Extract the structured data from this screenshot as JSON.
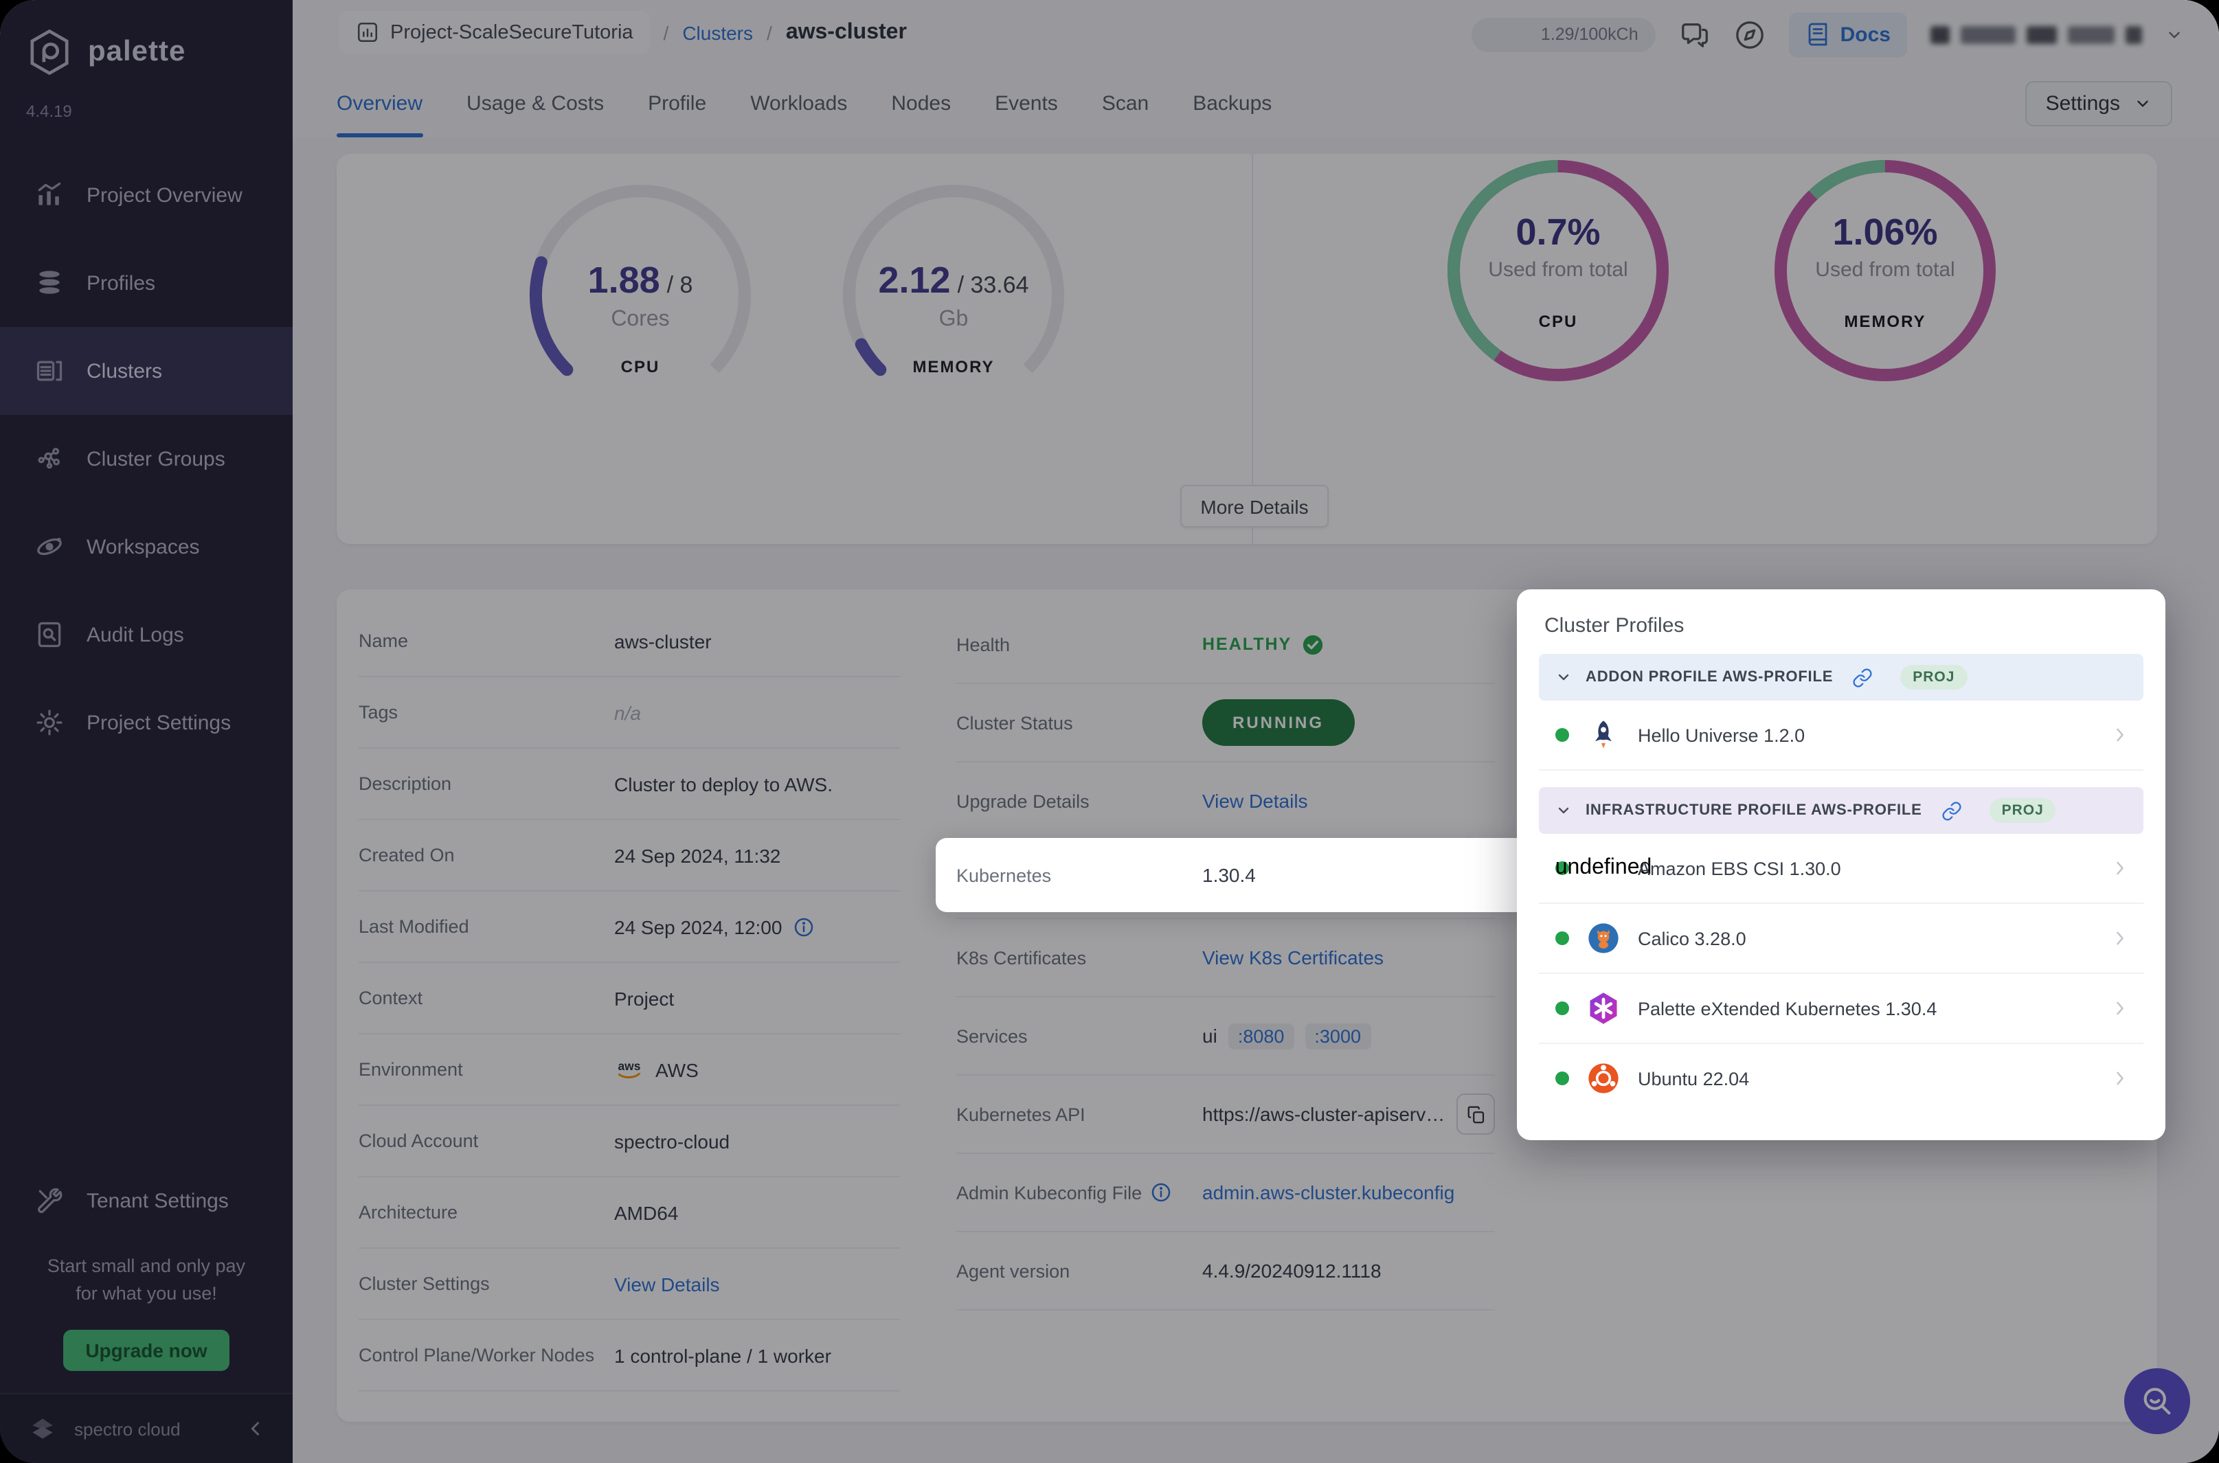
{
  "sidebar": {
    "logo_text": "palette",
    "version": "4.4.19",
    "items": [
      {
        "icon": "chart",
        "label": "Project Overview",
        "active": false
      },
      {
        "icon": "layers",
        "label": "Profiles",
        "active": false
      },
      {
        "icon": "server",
        "label": "Clusters",
        "active": true
      },
      {
        "icon": "network",
        "label": "Cluster Groups",
        "active": false
      },
      {
        "icon": "orbit",
        "label": "Workspaces",
        "active": false
      },
      {
        "icon": "audit",
        "label": "Audit Logs",
        "active": false
      },
      {
        "icon": "gear",
        "label": "Project Settings",
        "active": false
      }
    ],
    "tenant_item": {
      "icon": "tools",
      "label": "Tenant Settings"
    },
    "upsell_line1": "Start small and only pay",
    "upsell_line2": "for what you use!",
    "upgrade_label": "Upgrade now",
    "footer_brand": "spectro cloud"
  },
  "header": {
    "project_name": "Project-ScaleSecureTutoria",
    "breadcrumb_sep": "/",
    "clusters_link": "Clusters",
    "current": "aws-cluster",
    "usage_pill": "1.29/100kCh",
    "docs_label": "Docs",
    "settings_label": "Settings"
  },
  "tabs": {
    "active": "Overview",
    "items": [
      "Overview",
      "Usage & Costs",
      "Profile",
      "Workloads",
      "Nodes",
      "Events",
      "Scan",
      "Backups"
    ]
  },
  "gauges": {
    "cpu": {
      "value": "1.88",
      "total": "/ 8",
      "unit": "Cores",
      "label": "CPU",
      "used": 1.88,
      "capacity": 8
    },
    "memory": {
      "value": "2.12",
      "total": "/ 33.64",
      "unit": "Gb",
      "label": "MEMORY",
      "used": 2.12,
      "capacity": 33.64
    },
    "more_details_label": "More Details"
  },
  "donuts": {
    "cpu": {
      "percent_text": "0.7%",
      "caption": "Used from total",
      "label": "CPU",
      "green_fraction": 0.4
    },
    "memory": {
      "percent_text": "1.06%",
      "caption": "Used from total",
      "label": "MEMORY",
      "green_fraction": 0.12
    }
  },
  "details_left": [
    {
      "label": "Name",
      "type": "text",
      "value": "aws-cluster"
    },
    {
      "label": "Tags",
      "type": "na",
      "value": "n/a"
    },
    {
      "label": "Description",
      "type": "text",
      "value": "Cluster to deploy to AWS."
    },
    {
      "label": "Created On",
      "type": "text",
      "value": "24 Sep 2024, 11:32"
    },
    {
      "label": "Last Modified",
      "type": "text-info",
      "value": "24 Sep 2024, 12:00"
    },
    {
      "label": "Context",
      "type": "text",
      "value": "Project"
    },
    {
      "label": "Environment",
      "type": "env-aws",
      "value": "AWS"
    },
    {
      "label": "Cloud Account",
      "type": "text",
      "value": "spectro-cloud"
    },
    {
      "label": "Architecture",
      "type": "text",
      "value": "AMD64"
    },
    {
      "label": "Cluster Settings",
      "type": "link",
      "value": "View Details"
    },
    {
      "label": "Control Plane/Worker Nodes",
      "type": "text",
      "value": "1 control-plane / 1 worker"
    }
  ],
  "details_right": [
    {
      "label": "Health",
      "type": "health",
      "value": "HEALTHY"
    },
    {
      "label": "Cluster Status",
      "type": "pill",
      "value": "RUNNING"
    },
    {
      "label": "Upgrade Details",
      "type": "link",
      "value": "View Details"
    },
    {
      "label": "Kubernetes",
      "type": "text",
      "value": "1.30.4"
    },
    {
      "label": "K8s Certificates",
      "type": "link",
      "value": "View K8s Certificates"
    },
    {
      "label": "Services",
      "type": "services",
      "prefix": "ui",
      "ports": [
        ":8080",
        ":3000"
      ]
    },
    {
      "label": "Kubernetes API",
      "type": "api",
      "value": "https://aws-cluster-apiserve..."
    },
    {
      "label": "Admin Kubeconfig File",
      "label_info": true,
      "type": "link",
      "value": "admin.aws-cluster.kubeconfig"
    },
    {
      "label": "Agent version",
      "type": "text",
      "value": "4.4.9/20240912.1118"
    }
  ],
  "spotlight_row": {
    "label": "Kubernetes",
    "value": "1.30.4"
  },
  "cluster_profiles": {
    "title": "Cluster Profiles",
    "sections": [
      {
        "style": "addon",
        "header": "ADDON PROFILE AWS-PROFILE",
        "badge": "PROJ",
        "items": [
          {
            "icon": "hello-universe",
            "name": "Hello Universe 1.2.0"
          }
        ]
      },
      {
        "style": "infra",
        "header": "INFRASTRUCTURE PROFILE AWS-PROFILE",
        "badge": "PROJ",
        "items": [
          {
            "icon": "aws",
            "name": "Amazon EBS CSI 1.30.0"
          },
          {
            "icon": "calico",
            "name": "Calico 3.28.0"
          },
          {
            "icon": "pxk",
            "name": "Palette eXtended Kubernetes 1.30.4"
          },
          {
            "icon": "ubuntu",
            "name": "Ubuntu 22.04"
          }
        ]
      }
    ]
  },
  "colors": {
    "accent_blue": "#2e71d6",
    "gauge_purple": "#5f58bb",
    "donut_green": "#7ed0ab",
    "donut_magenta": "#c45ba8",
    "status_green": "#27a34e",
    "running_pill": "#207a42",
    "sidebar_bg": "#232136",
    "overlay": "rgba(14,14,20,0.40)"
  }
}
